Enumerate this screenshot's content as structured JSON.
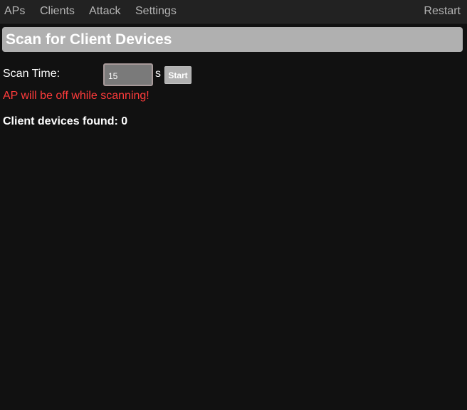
{
  "nav": {
    "aps": "APs",
    "clients": "Clients",
    "attack": "Attack",
    "settings": "Settings",
    "restart": "Restart"
  },
  "header": {
    "title": "Scan for Client Devices"
  },
  "scan": {
    "label": "Scan Time:",
    "value": "15",
    "unit": "s",
    "start_label": "Start",
    "warning": "AP will be off while scanning!"
  },
  "results": {
    "found_text": "Client devices found: 0"
  },
  "colors": {
    "background": "#111111",
    "navbar": "#222222",
    "header": "#b0b0b0",
    "warning": "#ff3b3b"
  }
}
